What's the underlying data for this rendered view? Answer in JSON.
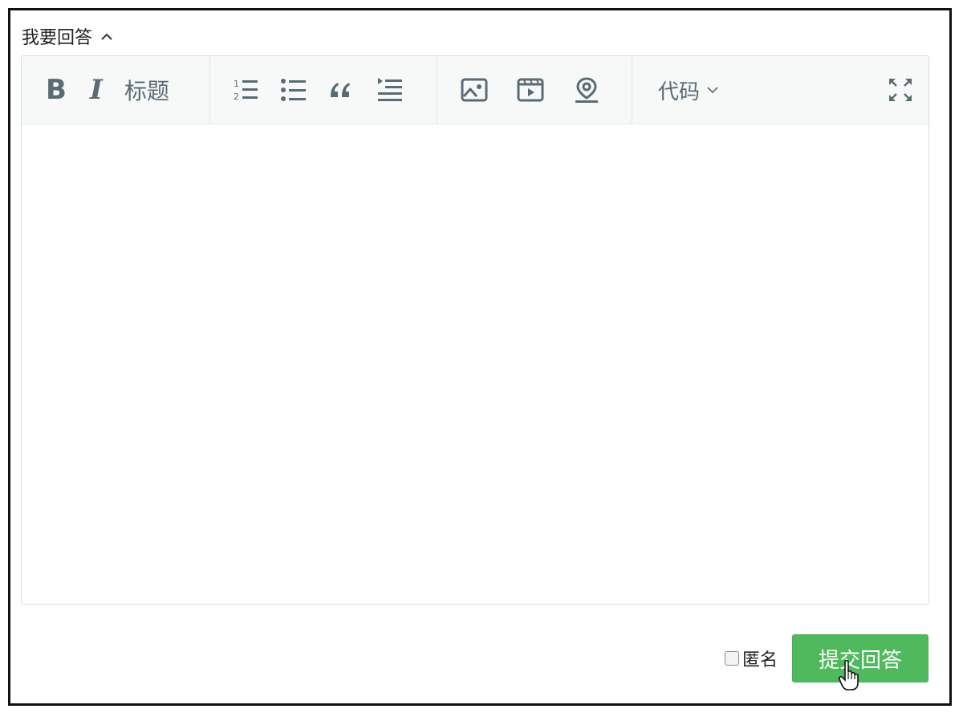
{
  "header": {
    "title": "我要回答"
  },
  "toolbar": {
    "bold_label": "B",
    "italic_label": "I",
    "heading_label": "标题",
    "code_label": "代码"
  },
  "editor": {
    "content": ""
  },
  "footer": {
    "anonymous_label": "匿名",
    "anonymous_checked": false,
    "submit_label": "提交回答"
  },
  "colors": {
    "accent": "#50b95d",
    "toolbar_bg": "#f7f9f9",
    "icon": "#5b6b72"
  },
  "icons": [
    "chevron-up-icon",
    "ordered-list-icon",
    "unordered-list-icon",
    "quote-icon",
    "indent-icon",
    "image-icon",
    "video-icon",
    "location-icon",
    "chevron-down-icon",
    "fullscreen-icon",
    "hand-cursor-icon"
  ]
}
